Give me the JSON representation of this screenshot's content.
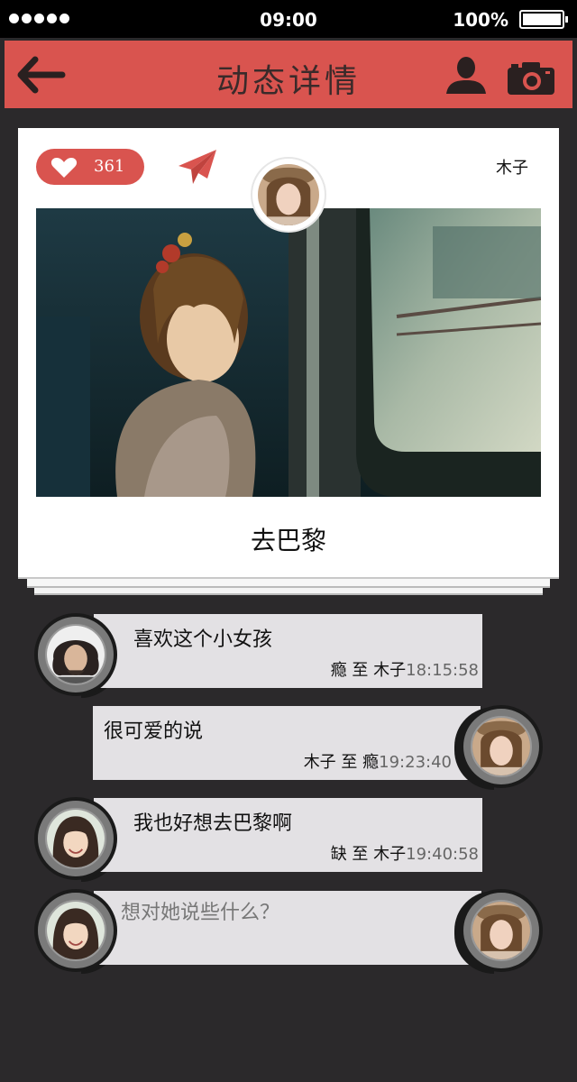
{
  "status_bar": {
    "time": "09:00",
    "battery": "100%"
  },
  "nav": {
    "title": "动态详情",
    "icons": [
      "back-arrow-icon",
      "profile-icon",
      "camera-icon"
    ]
  },
  "post": {
    "likes": "361",
    "author": "木子",
    "caption": "去巴黎",
    "photo": "girl-on-train-photo"
  },
  "comments": [
    {
      "text": "喜欢这个小女孩",
      "from": "瘾",
      "to": "木子",
      "conj": "至",
      "time": "18:15:58"
    },
    {
      "text": "很可爱的说",
      "from": "木子",
      "to": "瘾",
      "conj": "至",
      "time": "19:23:40"
    },
    {
      "text": "我也好想去巴黎啊",
      "from": "缺",
      "to": "木子",
      "conj": "至",
      "time": "19:40:58"
    }
  ],
  "composer": {
    "placeholder": "想对她说些什么？"
  },
  "colors": {
    "accent": "#d9544f",
    "background": "#2b292b",
    "bubble": "#e3e1e4"
  }
}
